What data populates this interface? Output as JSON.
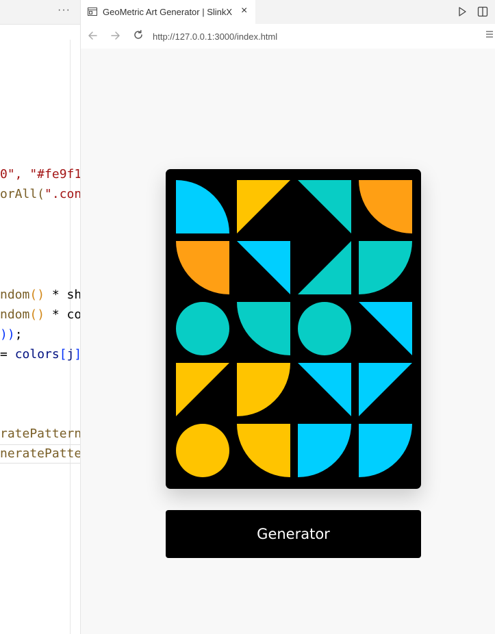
{
  "editor": {
    "more_label": "···",
    "lines": [
      {
        "segments": [
          {
            "text": "0\", \"#fe9f1",
            "cls": "tok-str"
          }
        ]
      },
      {
        "segments": [
          {
            "text": "orAll(",
            "cls": "tok-fn"
          },
          {
            "text": "\".con",
            "cls": "tok-str"
          }
        ]
      },
      {
        "segments": [
          {
            "text": "ndom",
            "cls": "tok-fn"
          },
          {
            "text": "()",
            "cls": "tok-paren"
          },
          {
            "text": " * sh",
            "cls": "tok-plain"
          }
        ]
      },
      {
        "segments": [
          {
            "text": "ndom",
            "cls": "tok-fn"
          },
          {
            "text": "()",
            "cls": "tok-paren"
          },
          {
            "text": " * co",
            "cls": "tok-plain"
          }
        ]
      },
      {
        "segments": [
          {
            "text": "))",
            "cls": "tok-sq"
          },
          {
            "text": ";",
            "cls": "tok-plain"
          }
        ]
      },
      {
        "segments": [
          {
            "text": "= ",
            "cls": "tok-plain"
          },
          {
            "text": "colors",
            "cls": "tok-var"
          },
          {
            "text": "[",
            "cls": "tok-sq"
          },
          {
            "text": "j",
            "cls": "tok-var"
          },
          {
            "text": "]",
            "cls": "tok-sq"
          }
        ]
      },
      {
        "segments": [
          {
            "text": "ratePattern",
            "cls": "tok-fn"
          }
        ]
      },
      {
        "segments": [
          {
            "text": "neratePatte",
            "cls": "tok-fn"
          }
        ]
      }
    ]
  },
  "browser": {
    "tab_title": "GeoMetric Art Generator | SlinkX",
    "close_icon": "×",
    "url": "http://127.0.0.1:3000/index.html"
  },
  "colors": {
    "blue": "#00cfff",
    "yellow": "#ffc400",
    "teal": "#08cdc5",
    "orange": "#ff9f14",
    "card": "#000000"
  },
  "pattern": [
    [
      {
        "shape": "quarter-tl",
        "color": "blue"
      },
      {
        "shape": "tri-tl",
        "color": "yellow"
      },
      {
        "shape": "tri-tr",
        "color": "teal"
      },
      {
        "shape": "quarter-tr",
        "color": "orange"
      }
    ],
    [
      {
        "shape": "quarter-bl",
        "color": "orange"
      },
      {
        "shape": "tri-tr",
        "color": "blue"
      },
      {
        "shape": "tri-br",
        "color": "teal"
      },
      {
        "shape": "quarter-tr",
        "color": "teal"
      }
    ],
    [
      {
        "shape": "circle",
        "color": "teal"
      },
      {
        "shape": "quarter-br",
        "color": "teal"
      },
      {
        "shape": "circle",
        "color": "teal"
      },
      {
        "shape": "tri-tr",
        "color": "blue"
      }
    ],
    [
      {
        "shape": "tri-tl",
        "color": "yellow"
      },
      {
        "shape": "quarter-tr",
        "color": "yellow"
      },
      {
        "shape": "tri-tr",
        "color": "blue"
      },
      {
        "shape": "tri-tl",
        "color": "blue"
      }
    ],
    [
      {
        "shape": "circle",
        "color": "yellow"
      },
      {
        "shape": "quarter-br",
        "color": "yellow"
      },
      {
        "shape": "quarter-br",
        "color": "blue"
      },
      {
        "shape": "quarter-br",
        "color": "blue"
      }
    ]
  ],
  "generator_button": {
    "label": "Generator"
  }
}
